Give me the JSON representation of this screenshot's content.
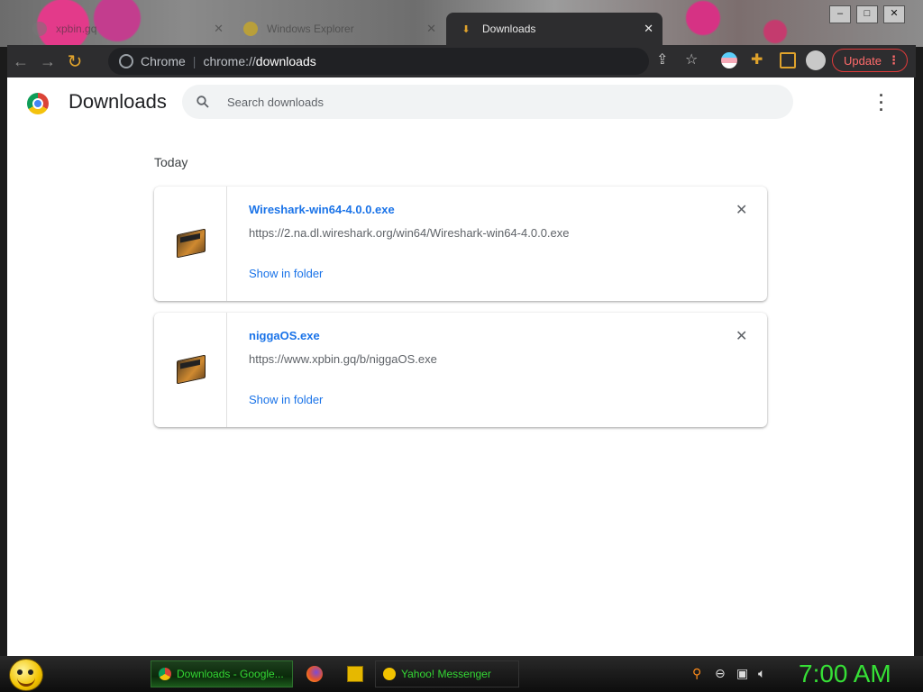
{
  "tabs": [
    {
      "label": "xpbin.gq",
      "active": false
    },
    {
      "label": "Windows Explorer",
      "active": false
    },
    {
      "label": "Downloads",
      "active": true
    }
  ],
  "toolbar": {
    "site_name": "Chrome",
    "url_prefix": "chrome://",
    "url_path": "downloads",
    "update_label": "Update"
  },
  "page": {
    "title": "Downloads",
    "search_placeholder": "Search downloads",
    "date_header": "Today",
    "downloads": [
      {
        "file_name": "Wireshark-win64-4.0.0.exe",
        "url": "https://2.na.dl.wireshark.org/win64/Wireshark-win64-4.0.0.exe",
        "action": "Show in folder"
      },
      {
        "file_name": "niggaOS.exe",
        "url": "https://www.xpbin.gq/b/niggaOS.exe",
        "action": "Show in folder"
      }
    ]
  },
  "taskbar": {
    "tasks": [
      {
        "label": "Downloads - Google..."
      },
      {
        "label": "Yahoo! Messenger"
      }
    ],
    "clock": "7:00 AM"
  },
  "colors": {
    "accent_link": "#1a73e8",
    "taskbar_text": "#34d834",
    "update_red": "#e03a3a"
  }
}
